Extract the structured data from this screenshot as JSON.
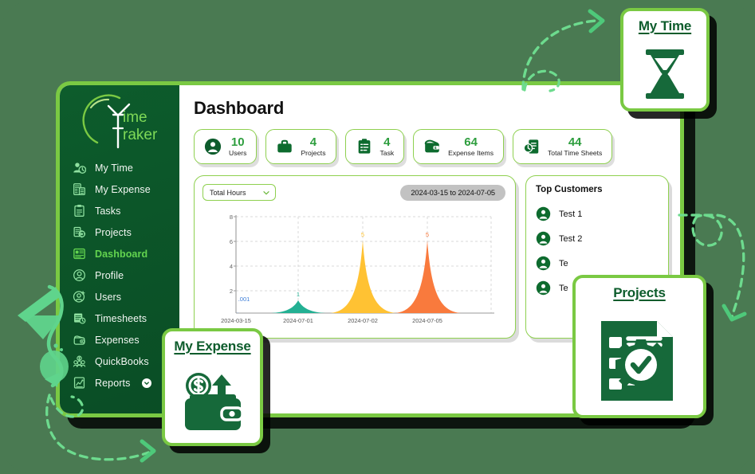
{
  "brand": {
    "logo_line1": "ime",
    "logo_line2": "raker",
    "logo_full": "Time Traker"
  },
  "colors": {
    "sidebar_bg": "#0d5c2c",
    "accent_green": "#7ac943",
    "active_item": "#63d44f",
    "stat_number": "#2e9e3e",
    "series_teal": "#23b093",
    "series_amber": "#ffc233",
    "series_orange": "#f97a3d",
    "daterange_bg": "#c2c2c2",
    "card_border": "#8ed04f"
  },
  "sidebar": {
    "items": [
      {
        "label": "My Time",
        "icon": "user-clock-icon",
        "active": false
      },
      {
        "label": "My Expense",
        "icon": "receipt-calc-icon",
        "active": false
      },
      {
        "label": "Tasks",
        "icon": "clipboard-list-icon",
        "active": false
      },
      {
        "label": "Projects",
        "icon": "projects-gear-icon",
        "active": false
      },
      {
        "label": "Dashboard",
        "icon": "dashboard-icon",
        "active": true
      },
      {
        "label": "Profile",
        "icon": "user-circle-icon",
        "active": false
      },
      {
        "label": "Users",
        "icon": "user-add-icon",
        "active": false
      },
      {
        "label": "Timesheets",
        "icon": "timesheet-icon",
        "active": false
      },
      {
        "label": "Expenses",
        "icon": "wallet-icon",
        "active": false
      },
      {
        "label": "QuickBooks",
        "icon": "quickbooks-icon",
        "active": false
      },
      {
        "label": "Reports",
        "icon": "report-chart-icon",
        "active": false,
        "chevron": "chevron-down-icon"
      }
    ]
  },
  "main": {
    "page_title": "Dashboard",
    "stats": [
      {
        "value": "10",
        "label": "Users",
        "icon": "user-icon"
      },
      {
        "value": "4",
        "label": "Projects",
        "icon": "briefcase-icon"
      },
      {
        "value": "4",
        "label": "Task",
        "icon": "clipboard-icon"
      },
      {
        "value": "64",
        "label": "Expense Items",
        "icon": "wallet-dollar-icon"
      },
      {
        "value": "44",
        "label": "Total Time Sheets",
        "icon": "timesheet-clock-icon"
      }
    ],
    "chart_panel": {
      "select_value": "Total Hours",
      "select_icon": "chevron-down-icon",
      "date_range": "2024-03-15 to 2024-07-05"
    },
    "customers_panel": {
      "title": "Top Customers",
      "items": [
        {
          "name": "Test 1",
          "icon": "avatar-icon"
        },
        {
          "name": "Test 2",
          "icon": "avatar-icon"
        },
        {
          "name": "Te",
          "icon": "avatar-icon"
        },
        {
          "name": "Te",
          "icon": "avatar-icon"
        }
      ]
    }
  },
  "chart_data": {
    "type": "area",
    "title": "",
    "xlabel": "",
    "ylabel": "",
    "categories": [
      "2024-03-15",
      "2024-07-01",
      "2024-07-02",
      "2024-07-05"
    ],
    "values": [
      0.001,
      1,
      5,
      5
    ],
    "point_labels": [
      ".001",
      "1",
      "5",
      "5"
    ],
    "series": [
      {
        "name": "2024-03-15",
        "values": [
          0.001
        ],
        "color": "#3f7fd8"
      },
      {
        "name": "2024-07-01",
        "values": [
          1
        ],
        "color": "#23b093"
      },
      {
        "name": "2024-07-02",
        "values": [
          5
        ],
        "color": "#ffc233"
      },
      {
        "name": "2024-07-05",
        "values": [
          5
        ],
        "color": "#f97a3d"
      }
    ],
    "ylim": [
      0,
      8
    ],
    "yticks": [
      2,
      4,
      6,
      8
    ],
    "grid": true,
    "legend": "none"
  },
  "floating_cards": [
    {
      "id": "mytime",
      "title": "My Time",
      "icon": "hourglass-icon"
    },
    {
      "id": "projects",
      "title": "Projects",
      "icon": "project-checklist-gear-icon"
    },
    {
      "id": "myexpense",
      "title": "My Expense",
      "icon": "wallet-dollar-up-icon"
    }
  ],
  "decorations": [
    {
      "name": "funnel-shape",
      "icon": "funnel-icon"
    },
    {
      "name": "dashed-arrow-top",
      "icon": "dashed-arrow-icon"
    },
    {
      "name": "dashed-arrow-right",
      "icon": "dashed-arrow-icon"
    },
    {
      "name": "dashed-arrow-bottom",
      "icon": "dashed-arrow-icon"
    }
  ]
}
